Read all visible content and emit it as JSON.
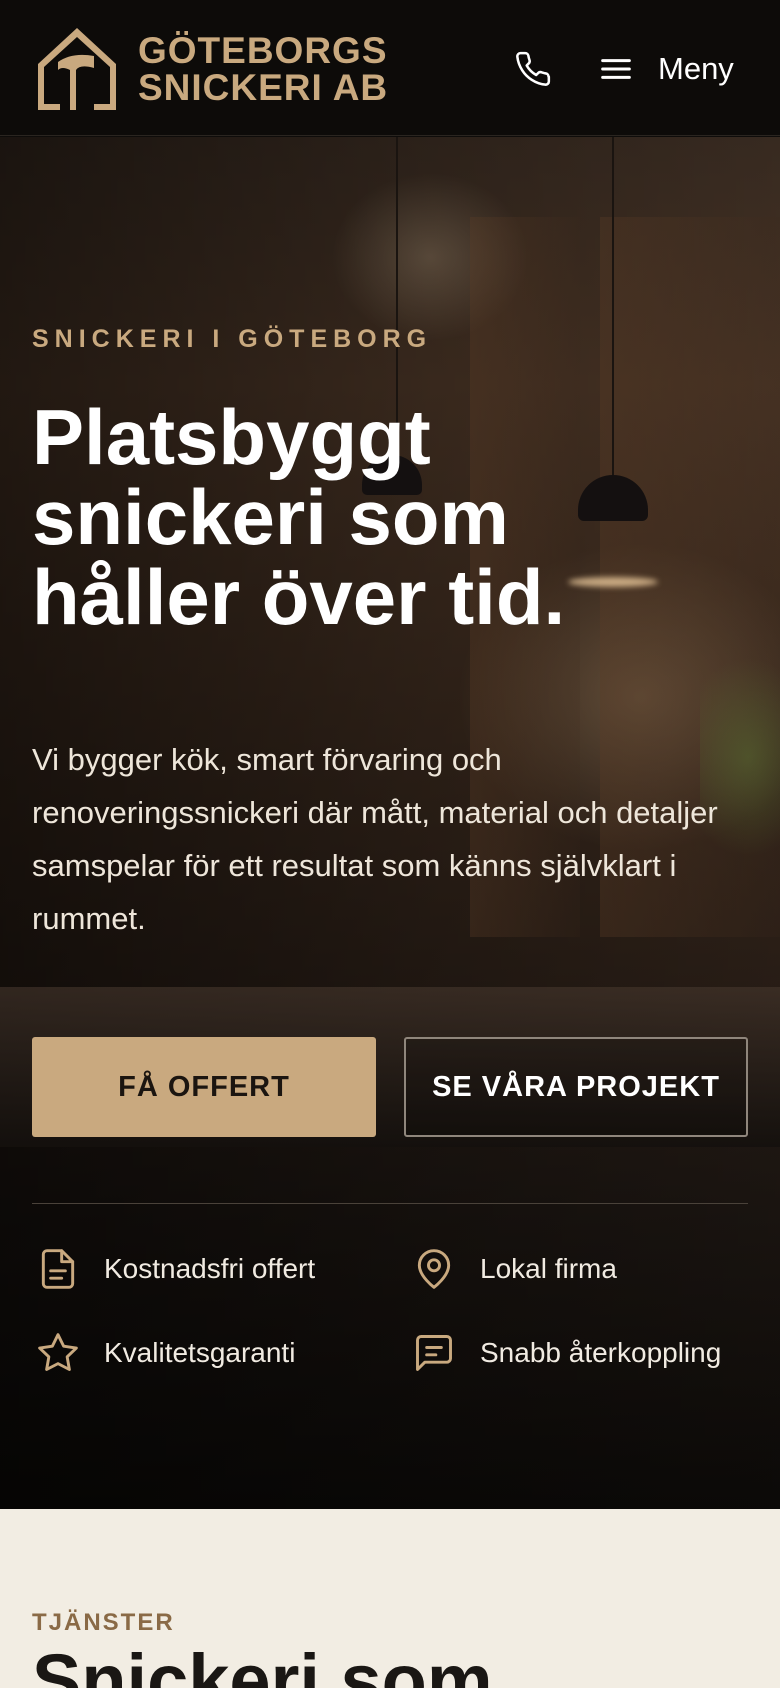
{
  "header": {
    "brand_line1": "GÖTEBORGS",
    "brand_line2": "SNICKERI AB",
    "logo_icon": "house-hammer-icon",
    "phone_icon": "phone-icon",
    "menu_icon": "hamburger-icon",
    "menu_label": "Meny"
  },
  "hero": {
    "eyebrow": "SNICKERI I GÖTEBORG",
    "headline_line1": "Platsbyggt",
    "headline_line2": "snickeri som",
    "headline_line3": "håller över tid.",
    "lede": "Vi bygger kök, smart förvaring och renoveringssnickeri där mått, material och detaljer samspelar för ett resultat som känns självklart i rummet.",
    "primary_cta": "FÅ OFFERT",
    "secondary_cta": "SE VÅRA PROJEKT",
    "features": [
      {
        "icon": "document-icon",
        "label": "Kostnadsfri offert"
      },
      {
        "icon": "location-pin-icon",
        "label": "Lokal firma"
      },
      {
        "icon": "star-icon",
        "label": "Kvalitetsgaranti"
      },
      {
        "icon": "chat-icon",
        "label": "Snabb återkoppling"
      }
    ]
  },
  "services": {
    "kicker": "TJÄNSTER",
    "title": "Snickeri som"
  },
  "colors": {
    "accent": "#c9a97f",
    "header_bg": "#0d0b09",
    "section_bg": "#f2ede3"
  }
}
